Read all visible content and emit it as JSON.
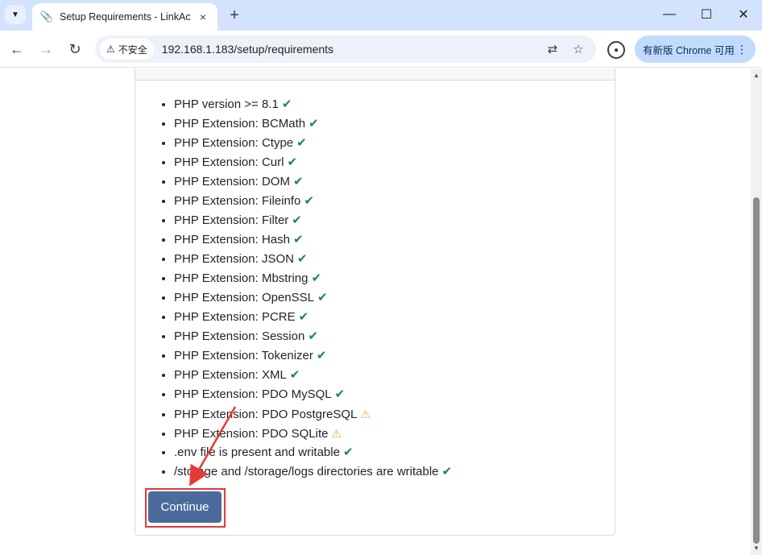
{
  "browser": {
    "tab_title": "Setup Requirements - LinkAc",
    "tab_close_icon": "×",
    "new_tab_icon": "+",
    "security_label": "不安全",
    "url": "192.168.1.183/setup/requirements",
    "update_label": "有新版 Chrome 可用",
    "update_more": "⋮"
  },
  "requirements": [
    {
      "label": "PHP version >= 8.1",
      "status": "ok"
    },
    {
      "label": "PHP Extension: BCMath",
      "status": "ok"
    },
    {
      "label": "PHP Extension: Ctype",
      "status": "ok"
    },
    {
      "label": "PHP Extension: Curl",
      "status": "ok"
    },
    {
      "label": "PHP Extension: DOM",
      "status": "ok"
    },
    {
      "label": "PHP Extension: Fileinfo",
      "status": "ok"
    },
    {
      "label": "PHP Extension: Filter",
      "status": "ok"
    },
    {
      "label": "PHP Extension: Hash",
      "status": "ok"
    },
    {
      "label": "PHP Extension: JSON",
      "status": "ok"
    },
    {
      "label": "PHP Extension: Mbstring",
      "status": "ok"
    },
    {
      "label": "PHP Extension: OpenSSL",
      "status": "ok"
    },
    {
      "label": "PHP Extension: PCRE",
      "status": "ok"
    },
    {
      "label": "PHP Extension: Session",
      "status": "ok"
    },
    {
      "label": "PHP Extension: Tokenizer",
      "status": "ok"
    },
    {
      "label": "PHP Extension: XML",
      "status": "ok"
    },
    {
      "label": "PHP Extension: PDO MySQL",
      "status": "ok"
    },
    {
      "label": "PHP Extension: PDO PostgreSQL",
      "status": "warning"
    },
    {
      "label": "PHP Extension: PDO SQLite",
      "status": "warning"
    },
    {
      "label": ".env file is present and writable",
      "status": "ok"
    },
    {
      "label": "/storage and /storage/logs directories are writable",
      "status": "ok"
    }
  ],
  "continue_label": "Continue",
  "colors": {
    "ok": "#198754",
    "warning": "#f0ad4e",
    "button": "#4a6b9c",
    "annotation": "#e53935"
  }
}
